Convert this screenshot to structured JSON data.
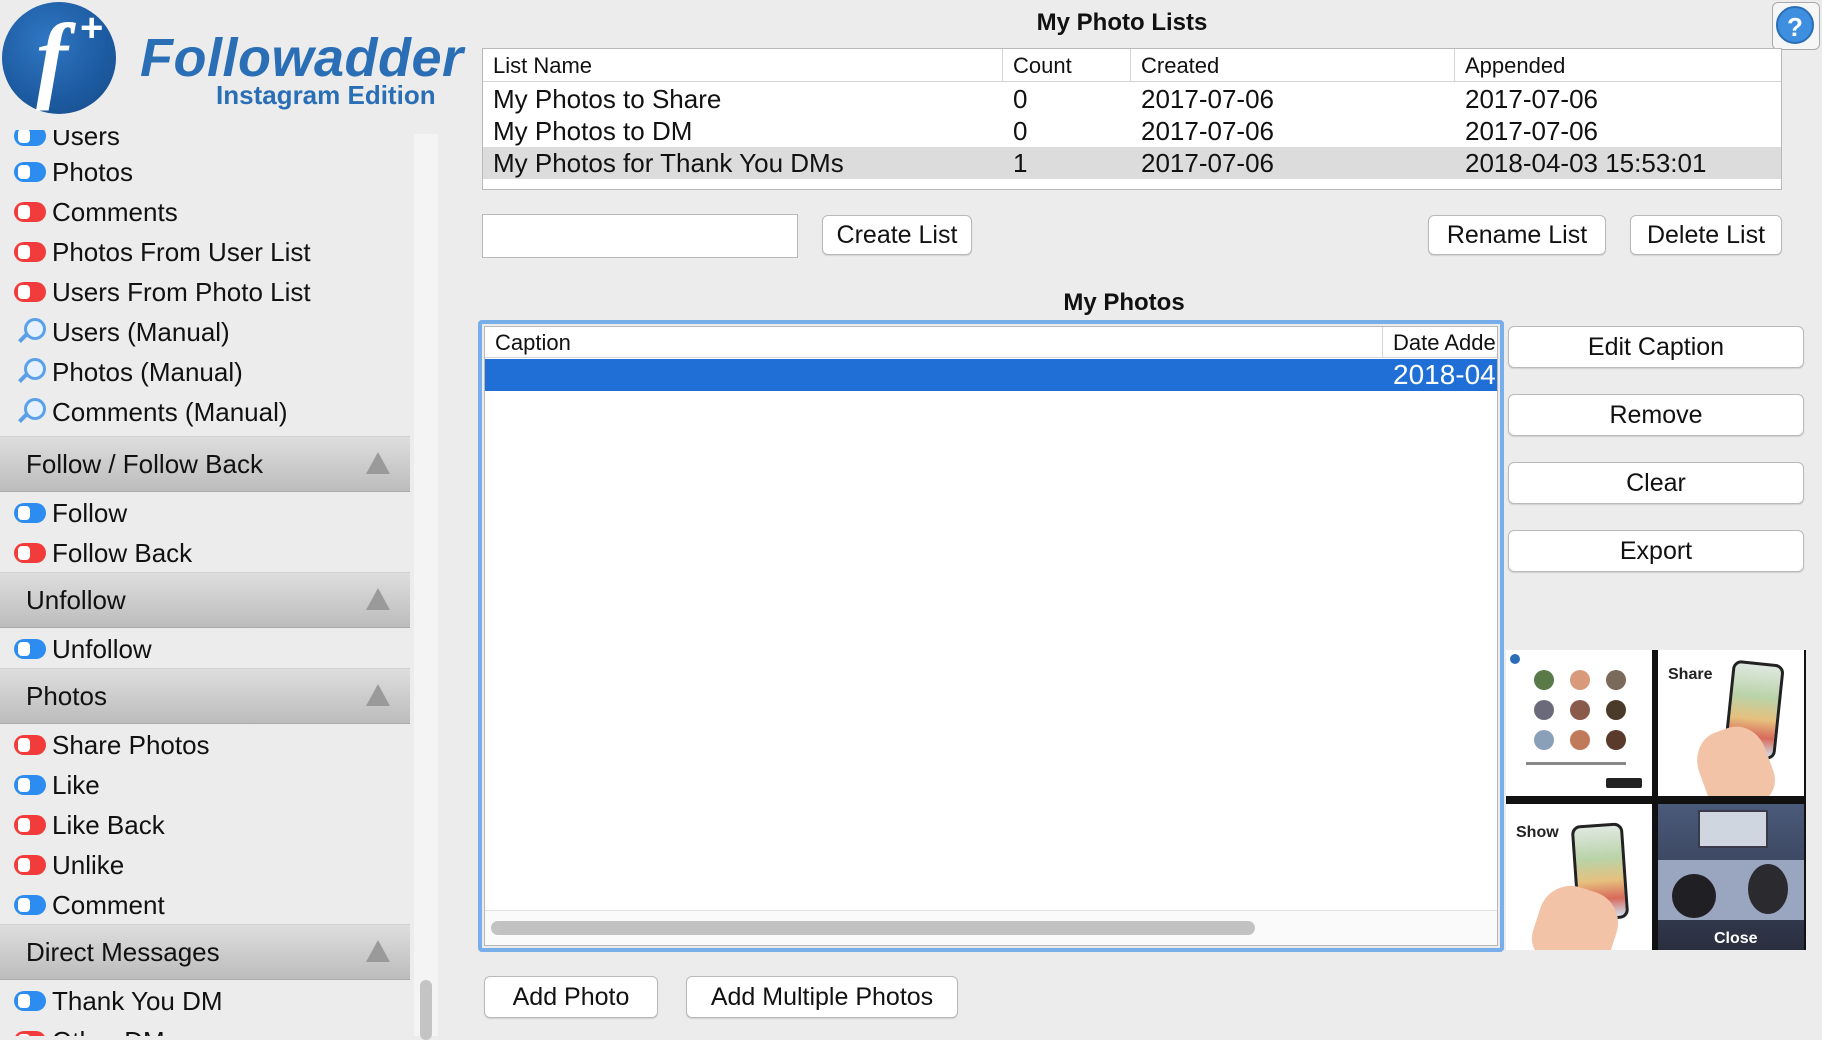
{
  "app": {
    "logo_name": "Followadder",
    "logo_edition": "Instagram Edition"
  },
  "sidebar": {
    "items_top": [
      {
        "label": "Users",
        "icon": "toggle-blue"
      },
      {
        "label": "Photos",
        "icon": "toggle-blue"
      },
      {
        "label": "Comments",
        "icon": "toggle-red"
      },
      {
        "label": "Photos From User List",
        "icon": "toggle-red"
      },
      {
        "label": "Users From Photo List",
        "icon": "toggle-red"
      },
      {
        "label": "Users (Manual)",
        "icon": "magnifier-icon"
      },
      {
        "label": "Photos (Manual)",
        "icon": "magnifier-icon"
      },
      {
        "label": "Comments (Manual)",
        "icon": "magnifier-icon"
      }
    ],
    "sections": [
      {
        "title": "Follow / Follow Back",
        "items": [
          {
            "label": "Follow",
            "icon": "toggle-blue"
          },
          {
            "label": "Follow Back",
            "icon": "toggle-red"
          }
        ]
      },
      {
        "title": "Unfollow",
        "items": [
          {
            "label": "Unfollow",
            "icon": "toggle-blue"
          }
        ]
      },
      {
        "title": "Photos",
        "items": [
          {
            "label": "Share Photos",
            "icon": "toggle-red"
          },
          {
            "label": "Like",
            "icon": "toggle-blue"
          },
          {
            "label": "Like Back",
            "icon": "toggle-red"
          },
          {
            "label": "Unlike",
            "icon": "toggle-red"
          },
          {
            "label": "Comment",
            "icon": "toggle-blue"
          }
        ]
      },
      {
        "title": "Direct Messages",
        "items": [
          {
            "label": "Thank You DM",
            "icon": "toggle-blue"
          },
          {
            "label": "Other DM",
            "icon": "toggle-red"
          }
        ]
      }
    ],
    "colors": {
      "toggle_on": "#2d8cf0",
      "toggle_off": "#f23b3b"
    }
  },
  "photo_lists": {
    "title": "My Photo Lists",
    "help_label": "?",
    "columns": [
      "List Name",
      "Count",
      "Created",
      "Appended"
    ],
    "rows": [
      {
        "name": "My Photos to Share",
        "count": "0",
        "created": "2017-07-06",
        "appended": "2017-07-06",
        "selected": false
      },
      {
        "name": "My Photos to DM",
        "count": "0",
        "created": "2017-07-06",
        "appended": "2017-07-06",
        "selected": false
      },
      {
        "name": "My Photos for Thank You DMs",
        "count": "1",
        "created": "2017-07-06",
        "appended": "2018-04-03 15:53:01",
        "selected": true
      }
    ],
    "new_list_input_value": "",
    "create_label": "Create List",
    "rename_label": "Rename List",
    "delete_label": "Delete List"
  },
  "my_photos": {
    "title": "My Photos",
    "columns": [
      "Caption",
      "Date Adde"
    ],
    "rows": [
      {
        "caption": "",
        "date": "2018-04",
        "selected": true
      }
    ],
    "actions": {
      "edit_caption": "Edit Caption",
      "remove": "Remove",
      "clear": "Clear",
      "export": "Export"
    },
    "add_photo_label": "Add Photo",
    "add_multiple_label": "Add Multiple Photos",
    "selection_color": "#1f6fd6"
  },
  "preview": {
    "captions": [
      "Share",
      "Show",
      "Close"
    ]
  }
}
